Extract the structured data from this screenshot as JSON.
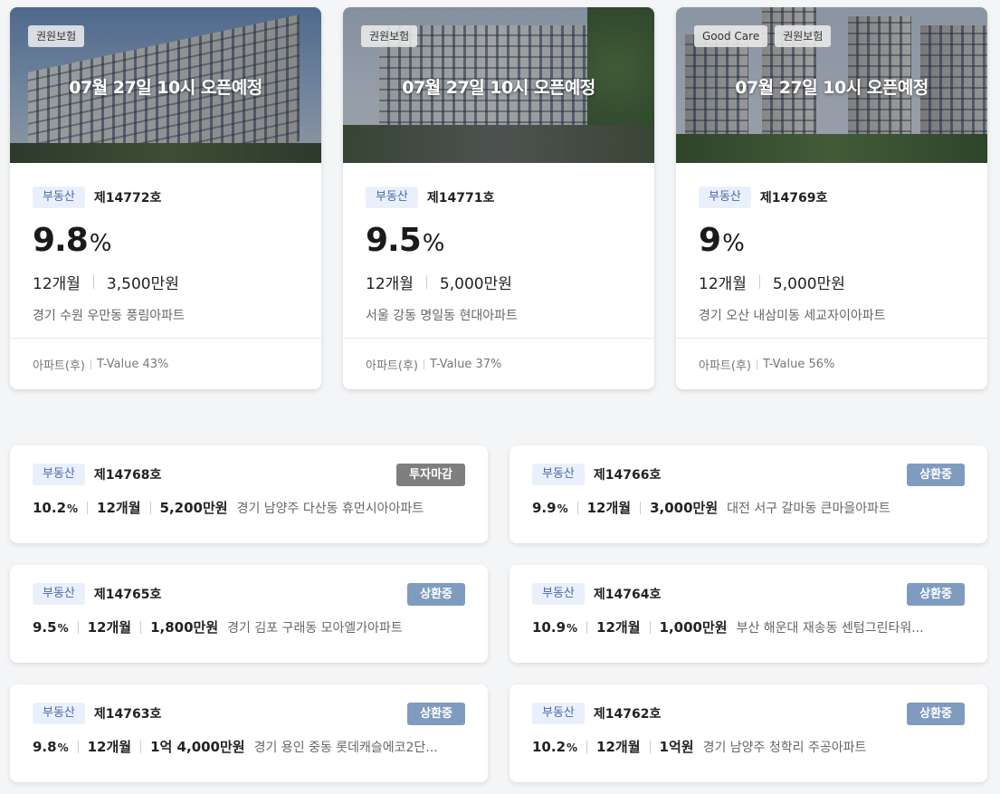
{
  "colors": {
    "category_bg": "#eaf0fb",
    "category_text": "#4a6ba8",
    "status_closed": "#7f7f7f",
    "status_repaying": "#7f9cbf"
  },
  "featured": [
    {
      "tags": [
        "권원보험"
      ],
      "open_label": "07월 27일 10시 오픈예정",
      "category": "부동산",
      "number": "제14772호",
      "rate": "9.8",
      "rate_unit": "%",
      "period": "12개월",
      "amount": "3,500만원",
      "address": "경기 수원 우만동 풍림아파트",
      "type": "아파트(후)",
      "tvalue": "T-Value 43%"
    },
    {
      "tags": [
        "권원보험"
      ],
      "open_label": "07월 27일 10시 오픈예정",
      "category": "부동산",
      "number": "제14771호",
      "rate": "9.5",
      "rate_unit": "%",
      "period": "12개월",
      "amount": "5,000만원",
      "address": "서울 강동 명일동 현대아파트",
      "type": "아파트(후)",
      "tvalue": "T-Value 37%"
    },
    {
      "tags": [
        "Good Care",
        "권원보험"
      ],
      "open_label": "07월 27일 10시 오픈예정",
      "category": "부동산",
      "number": "제14769호",
      "rate": "9",
      "rate_unit": "%",
      "period": "12개월",
      "amount": "5,000만원",
      "address": "경기 오산 내삼미동 세교자이아파트",
      "type": "아파트(후)",
      "tvalue": "T-Value 56%"
    }
  ],
  "items": [
    {
      "category": "부동산",
      "number": "제14768호",
      "status": "투자마감",
      "rate": "10.2",
      "rate_unit": "%",
      "period": "12개월",
      "amount": "5,200만원",
      "address": "경기 남양주 다산동 휴먼시아아파트"
    },
    {
      "category": "부동산",
      "number": "제14766호",
      "status": "상환중",
      "rate": "9.9",
      "rate_unit": "%",
      "period": "12개월",
      "amount": "3,000만원",
      "address": "대전 서구 갈마동 큰마을아파트"
    },
    {
      "category": "부동산",
      "number": "제14765호",
      "status": "상환중",
      "rate": "9.5",
      "rate_unit": "%",
      "period": "12개월",
      "amount": "1,800만원",
      "address": "경기 김포 구래동 모아엘가아파트"
    },
    {
      "category": "부동산",
      "number": "제14764호",
      "status": "상환중",
      "rate": "10.9",
      "rate_unit": "%",
      "period": "12개월",
      "amount": "1,000만원",
      "address": "부산 해운대 재송동 센텀그린타워..."
    },
    {
      "category": "부동산",
      "number": "제14763호",
      "status": "상환중",
      "rate": "9.8",
      "rate_unit": "%",
      "period": "12개월",
      "amount": "1억 4,000만원",
      "address": "경기 용인 중동 롯데캐슬에코2단..."
    },
    {
      "category": "부동산",
      "number": "제14762호",
      "status": "상환중",
      "rate": "10.2",
      "rate_unit": "%",
      "period": "12개월",
      "amount": "1억원",
      "address": "경기 남양주 청학리 주공아파트"
    }
  ]
}
